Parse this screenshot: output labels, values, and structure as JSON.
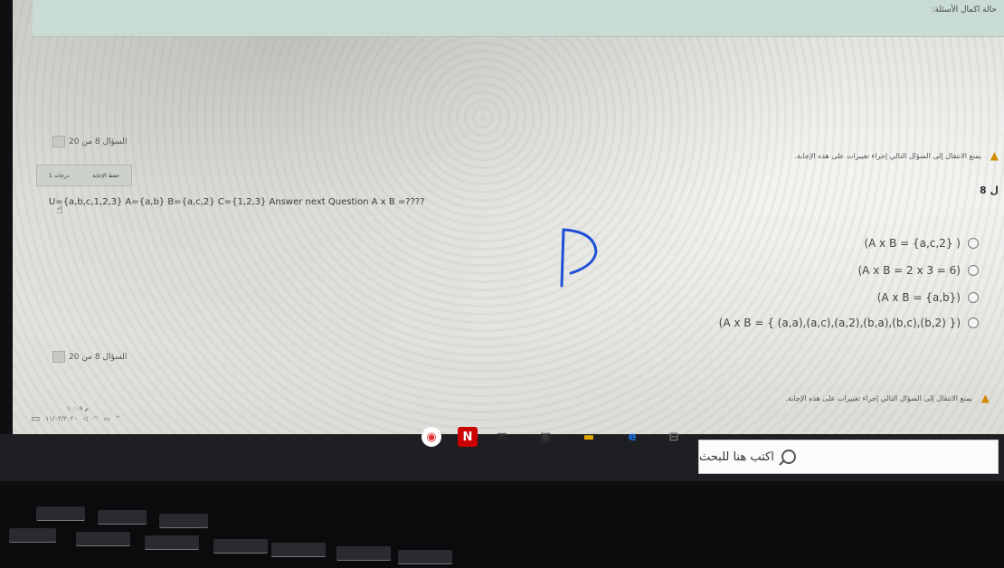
{
  "banner": {
    "text": "حالة اكمال الأسئلة:"
  },
  "nav": {
    "counter": "السؤال 8 من 20"
  },
  "warning": {
    "text": "يمنع الانتقال إلى السؤال التالي إجراء تغييرات على هذه الإجابة."
  },
  "question": {
    "points": "1 درجات",
    "save_label": "حفظ الإجابة",
    "number": "8 ل",
    "text": "U={a,b,c,1,2,3} A={a,b} B={a,c,2} C={1,2,3} Answer next Question A x B =????",
    "options": [
      "(A x B = {a,c,2} )",
      "(A x B = 2 x 3 = 6)",
      "(A x B = {a,b})",
      "(A x B = { (a,a),(a,c),(a,2),(b,a),(b,c),(b,2) })"
    ]
  },
  "annotation": {
    "handwritten": "D"
  },
  "taskbar": {
    "search_placeholder": "اكتب هنا للبحث",
    "tray_line1": "م ١٠:٠٩",
    "tray_line2": "١١/٠٣/٢٠٢٠",
    "icons": [
      "chrome-icon",
      "netflix-icon",
      "mail-icon",
      "store-icon",
      "file-explorer-icon",
      "edge-icon",
      "task-view-icon"
    ]
  },
  "colors": {
    "banner": "#c9dcd4",
    "pen": "#1f4fd8",
    "warning": "#d08a00"
  }
}
